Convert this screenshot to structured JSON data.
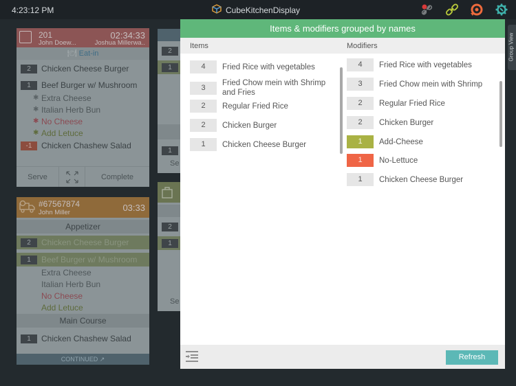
{
  "topbar": {
    "time": "4:23:12 PM",
    "app_title": "CubeKitchenDisplay",
    "icons": [
      "disconnected-link-icon",
      "link-icon",
      "refresh-sync-icon",
      "settings-gear-icon"
    ]
  },
  "cards": {
    "card1": {
      "table": "201",
      "timer": "02:34:33",
      "server": "John Doew...",
      "customer": "Joshua Millerwa..",
      "service_type": "Eat-in",
      "items": [
        {
          "qty": "2",
          "name": "Chicken Cheese Burger"
        },
        {
          "qty": "1",
          "name": "Beef Burger w/ Mushroom"
        },
        {
          "qty": "-1",
          "name": "Chicken Chashew Salad"
        }
      ],
      "modifiers": [
        "Extra Cheese",
        "Italian Herb Bun",
        "No Cheese",
        "Add Letuce"
      ],
      "footer": {
        "serve": "Serve",
        "complete": "Complete"
      }
    },
    "card2": {
      "order_no": "#67567874",
      "customer": "John Miller",
      "timer": "03:33",
      "sections": [
        "Appetizer",
        "Main Course"
      ],
      "items": [
        {
          "qty": "2",
          "name": "Chicken Cheese Burger"
        },
        {
          "qty": "1",
          "name": "Beef Burger w/ Mushroom"
        },
        {
          "qty": "1",
          "name": "Chicken Chashew Salad"
        }
      ],
      "modifiers": [
        "Extra Cheese",
        "Italian Herb Bun",
        "No Cheese",
        "Add Letuce"
      ],
      "continued": "CONTINUED"
    },
    "card3": {
      "qtys": [
        "2",
        "1",
        "1"
      ],
      "serve": "Se"
    },
    "card4": {
      "qtys": [
        "2",
        "1"
      ],
      "serve": "Se"
    }
  },
  "modal": {
    "title": "Items & modifiers grouped by names",
    "items_header": "Items",
    "modifiers_header": "Modifiers",
    "items": [
      {
        "qty": "4",
        "name": "Fried Rice with vegetables"
      },
      {
        "qty": "3",
        "name": "Fried Chow mein with Shrimp and Fries"
      },
      {
        "qty": "2",
        "name": "Regular Fried Rice"
      },
      {
        "qty": "2",
        "name": "Chicken Burger"
      },
      {
        "qty": "1",
        "name": "Chicken Cheese Burger"
      }
    ],
    "modifiers": [
      {
        "qty": "4",
        "name": "Fried Rice with vegetables",
        "style": "plain"
      },
      {
        "qty": "3",
        "name": "Fried Chow mein with Shrimp",
        "style": "plain"
      },
      {
        "qty": "2",
        "name": "Regular Fried Rice",
        "style": "plain"
      },
      {
        "qty": "2",
        "name": "Chicken Burger",
        "style": "plain"
      },
      {
        "qty": "1",
        "name": "Add-Cheese",
        "style": "olive"
      },
      {
        "qty": "1",
        "name": "No-Lettuce",
        "style": "orange"
      },
      {
        "qty": "1",
        "name": "Chicken Cheese Burger",
        "style": "plain"
      }
    ],
    "refresh_label": "Refresh"
  },
  "side_tab": {
    "label": "Group View"
  },
  "colors": {
    "header_green": "#5fb77a",
    "refresh_teal": "#5cb8b6",
    "badge_olive": "#a9b244",
    "badge_orange": "#ef6546"
  }
}
